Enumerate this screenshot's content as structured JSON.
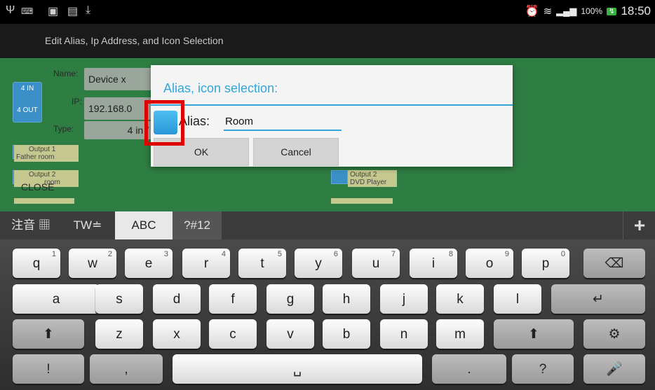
{
  "status_bar": {
    "time": "18:50",
    "battery_pct": "100%",
    "icons": [
      "usb-icon",
      "keyboard-icon",
      "sim-icon",
      "image-icon",
      "download-icon",
      "alarm-icon",
      "wifi-icon",
      "signal-icon",
      "battery-charging-icon"
    ]
  },
  "title_bar": {
    "title": "Edit Alias, Ip Address, and Icon Selection"
  },
  "form": {
    "name_label": "Name:",
    "name_value": "Device x",
    "ip_label": "IP:",
    "ip_value": "192.168.0",
    "type_label": "Type:",
    "type_value": "4 in /",
    "device_icon_top": "4 IN",
    "device_icon_bottom": "4 OUT",
    "outputs": [
      {
        "label": "Output 1",
        "alias": "Father room"
      },
      {
        "label": "Output 2",
        "alias": "room"
      }
    ],
    "right_output": {
      "label": "Output 2",
      "alias": "DVD Player"
    },
    "close_label": "CLOSE"
  },
  "dialog": {
    "title": "Alias, icon selection:",
    "alias_label": "Alias:",
    "alias_value": "Room",
    "ok_label": "OK",
    "cancel_label": "Cancel"
  },
  "keyboard": {
    "modes": [
      "注音",
      "TW",
      "ABC",
      "?#12"
    ],
    "active_mode": "ABC",
    "row1": [
      {
        "k": "q",
        "n": "1"
      },
      {
        "k": "w",
        "n": "2"
      },
      {
        "k": "e",
        "n": "3"
      },
      {
        "k": "r",
        "n": "4"
      },
      {
        "k": "t",
        "n": "5"
      },
      {
        "k": "y",
        "n": "6"
      },
      {
        "k": "u",
        "n": "7"
      },
      {
        "k": "i",
        "n": "8"
      },
      {
        "k": "o",
        "n": "9"
      },
      {
        "k": "p",
        "n": "0"
      }
    ],
    "row2": [
      "a",
      "s",
      "d",
      "f",
      "g",
      "h",
      "j",
      "k",
      "l"
    ],
    "row3": [
      "z",
      "x",
      "c",
      "v",
      "b",
      "n",
      "m"
    ],
    "row4": {
      "left": "!",
      "comma": ",",
      "dot": ".",
      "question": "?"
    },
    "plus_label": "+"
  },
  "colors": {
    "accent": "#33a6d6",
    "app_bg": "#2e7d43",
    "highlight": "#e00000"
  }
}
